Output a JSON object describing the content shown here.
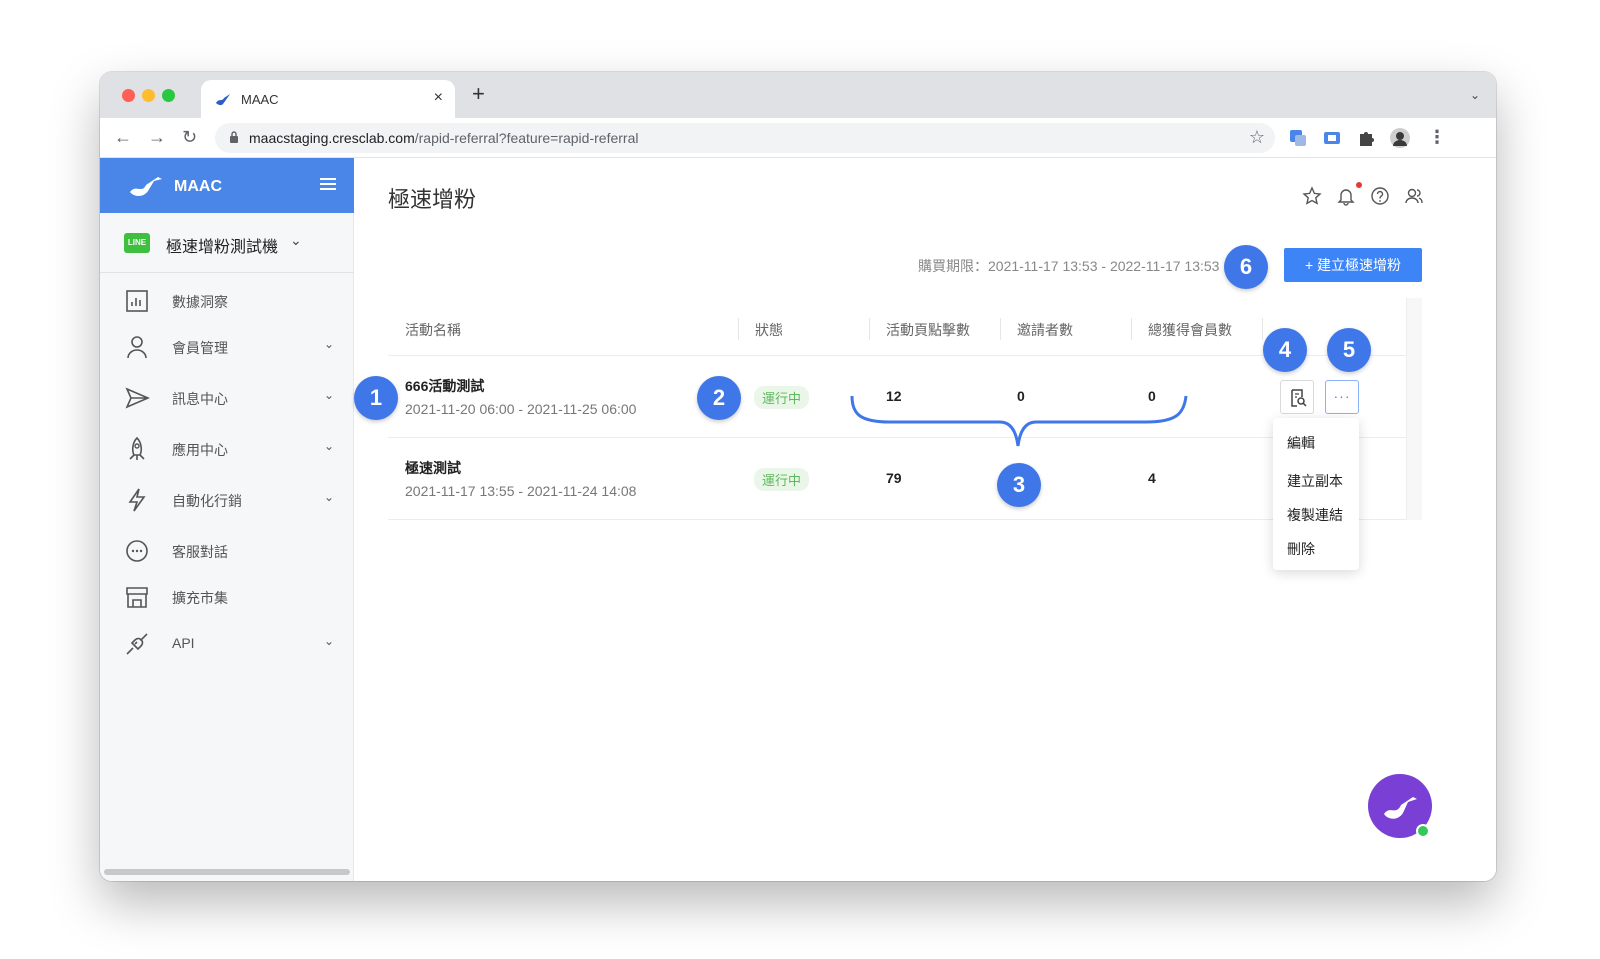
{
  "browser": {
    "tab_title": "MAAC",
    "new_tab": "+",
    "tab_close": "×",
    "url_host": "maacstaging.cresclab.com",
    "url_path": "/rapid-referral?feature=rapid-referral"
  },
  "sidebar": {
    "brand": "MAAC",
    "account_badge": "LINE",
    "account_name": "極速增粉測試機",
    "items": [
      {
        "label": "數據洞察",
        "icon": "chart-icon",
        "expandable": false
      },
      {
        "label": "會員管理",
        "icon": "person-icon",
        "expandable": true
      },
      {
        "label": "訊息中心",
        "icon": "send-icon",
        "expandable": true
      },
      {
        "label": "應用中心",
        "icon": "rocket-icon",
        "expandable": true
      },
      {
        "label": "自動化行銷",
        "icon": "bolt-icon",
        "expandable": true
      },
      {
        "label": "客服對話",
        "icon": "chat-bubble-icon",
        "expandable": false
      },
      {
        "label": "擴充市集",
        "icon": "store-icon",
        "expandable": false
      },
      {
        "label": "API",
        "icon": "plug-icon",
        "expandable": true
      }
    ]
  },
  "main": {
    "title": "極速增粉",
    "purchase_period": "購買期限：2021-11-17 13:53 - 2022-11-17 13:53",
    "create_button": "+ 建立極速增粉",
    "columns": [
      "活動名稱",
      "狀態",
      "活動頁點擊數",
      "邀請者數",
      "總獲得會員數"
    ],
    "rows": [
      {
        "name": "666活動測試",
        "date": "2021-11-20 06:00 - 2021-11-25 06:00",
        "status": "運行中",
        "clicks": "12",
        "inviters": "0",
        "members": "0"
      },
      {
        "name": "極速測試",
        "date": "2021-11-17 13:55 - 2021-11-24 14:08",
        "status": "運行中",
        "clicks": "79",
        "inviters": "",
        "members": "4"
      }
    ],
    "more_menu": [
      "編輯",
      "建立副本",
      "複製連結",
      "刪除"
    ],
    "more_label": "···"
  },
  "callouts": [
    "1",
    "2",
    "3",
    "4",
    "5",
    "6"
  ],
  "colors": {
    "brand_blue": "#4a86e8",
    "callout_blue": "#3f76e8",
    "status_green": "#5cb85c",
    "chat_purple": "#7a3fd4"
  }
}
